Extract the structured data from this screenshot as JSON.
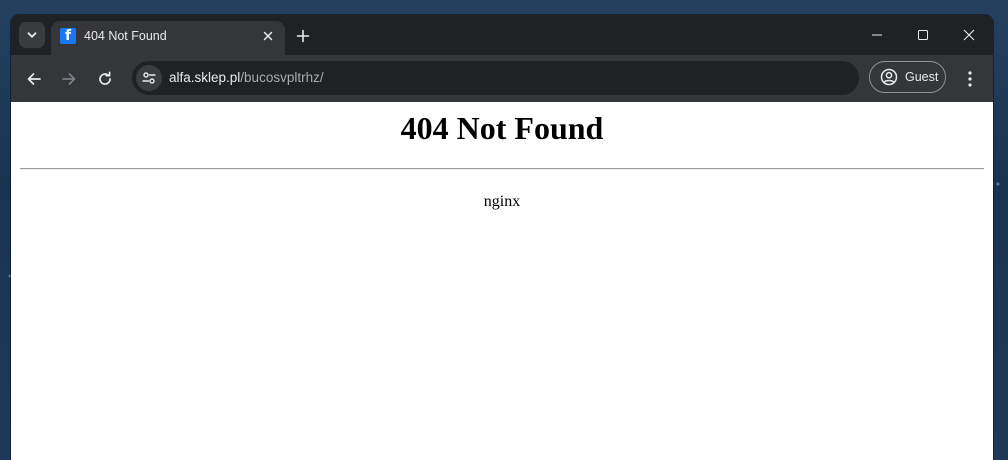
{
  "browser": {
    "tab": {
      "title": "404 Not Found",
      "favicon_letter": "f",
      "favicon_color": "#1877f2"
    },
    "address_bar": {
      "host": "alfa.sklep.pl",
      "path": "/bucosvpltrhz/"
    },
    "profile": {
      "label": "Guest"
    },
    "icons": {
      "tab_search": "chevron-down-icon",
      "tab_close": "close-icon",
      "new_tab": "plus-icon",
      "back": "arrow-left-icon",
      "forward": "arrow-right-icon",
      "reload": "reload-icon",
      "site_info": "tune-icon",
      "profile": "account-circle-icon",
      "menu": "more-vertical-icon",
      "minimize": "minimize-icon",
      "maximize": "maximize-icon",
      "close_window": "close-icon"
    },
    "colors": {
      "frame": "#202124",
      "toolbar": "#35363a",
      "text": "#e8eaed"
    }
  },
  "page": {
    "heading": "404 Not Found",
    "server": "nginx"
  }
}
